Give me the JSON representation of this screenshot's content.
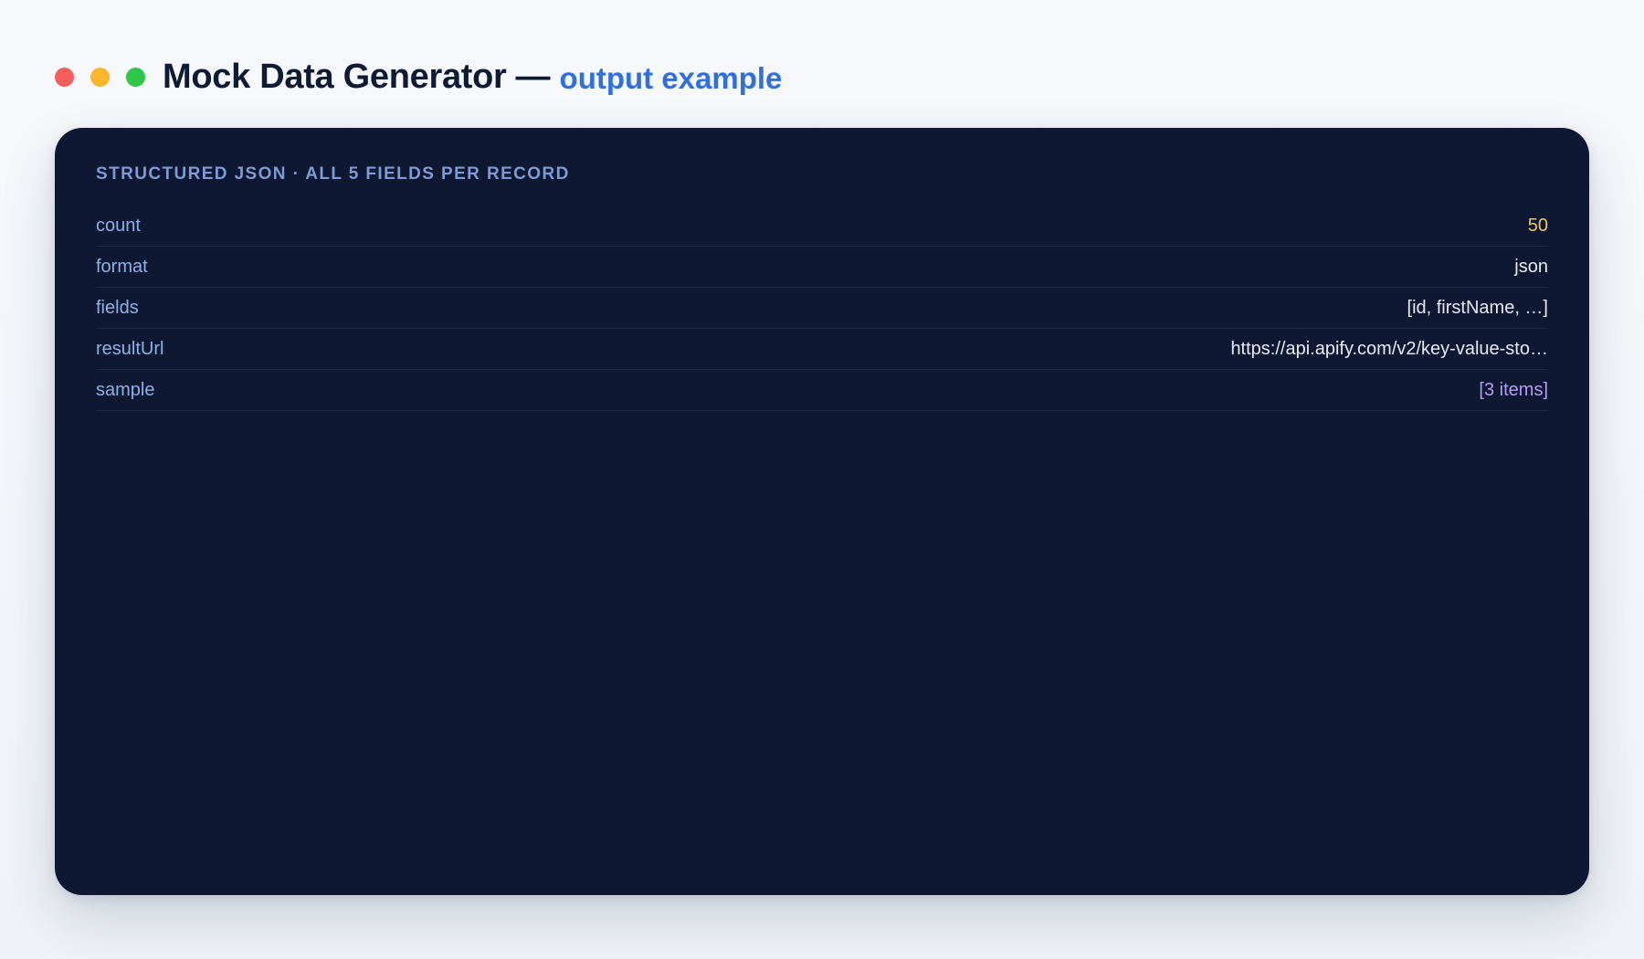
{
  "window": {
    "controls": [
      {
        "name": "close",
        "color": "#f25f5c"
      },
      {
        "name": "minimize",
        "color": "#fbb62b"
      },
      {
        "name": "maximize",
        "color": "#2fc74a"
      }
    ]
  },
  "header": {
    "title": "Mock Data Generator",
    "separator": "—",
    "subtitle": "output example"
  },
  "panel": {
    "heading": "STRUCTURED JSON · ALL 5 FIELDS PER RECORD",
    "rows": [
      {
        "key": "count",
        "value": "50",
        "kind": "number"
      },
      {
        "key": "format",
        "value": "json",
        "kind": "string"
      },
      {
        "key": "fields",
        "value": "[id, firstName, …]",
        "kind": "string"
      },
      {
        "key": "resultUrl",
        "value": "https://api.apify.com/v2/key-value-sto…",
        "kind": "string"
      },
      {
        "key": "sample",
        "value": "[3 items]",
        "kind": "array"
      }
    ]
  },
  "colors": {
    "panel_bg": "#0e1833",
    "accent": "#2f6fe0",
    "key": "#8fb1e6",
    "number": "#f2c46d",
    "array": "#b79cf5"
  }
}
